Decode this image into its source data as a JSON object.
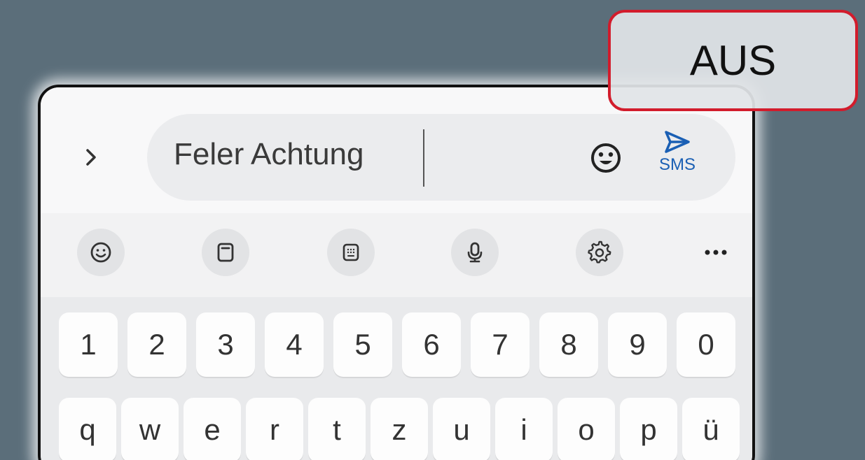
{
  "badge": {
    "label": "AUS",
    "border_color": "#d21c2c"
  },
  "input": {
    "value": "Feler Achtung",
    "send_label": "SMS",
    "expand_icon": "chevron-right-icon",
    "emoji_icon": "smiley-icon",
    "send_icon": "send-arrow-icon"
  },
  "toolbar": {
    "items": [
      {
        "icon": "emoji-icon"
      },
      {
        "icon": "clipboard-icon"
      },
      {
        "icon": "keypad-icon"
      },
      {
        "icon": "microphone-icon"
      },
      {
        "icon": "settings-gear-icon"
      },
      {
        "icon": "more-icon"
      }
    ]
  },
  "keyboard": {
    "number_row": [
      "1",
      "2",
      "3",
      "4",
      "5",
      "6",
      "7",
      "8",
      "9",
      "0"
    ],
    "letter_row": [
      "q",
      "w",
      "e",
      "r",
      "t",
      "z",
      "u",
      "i",
      "o",
      "p",
      "ü"
    ]
  },
  "colors": {
    "accent": "#1a5fb4",
    "background": "#5b6e7a"
  }
}
